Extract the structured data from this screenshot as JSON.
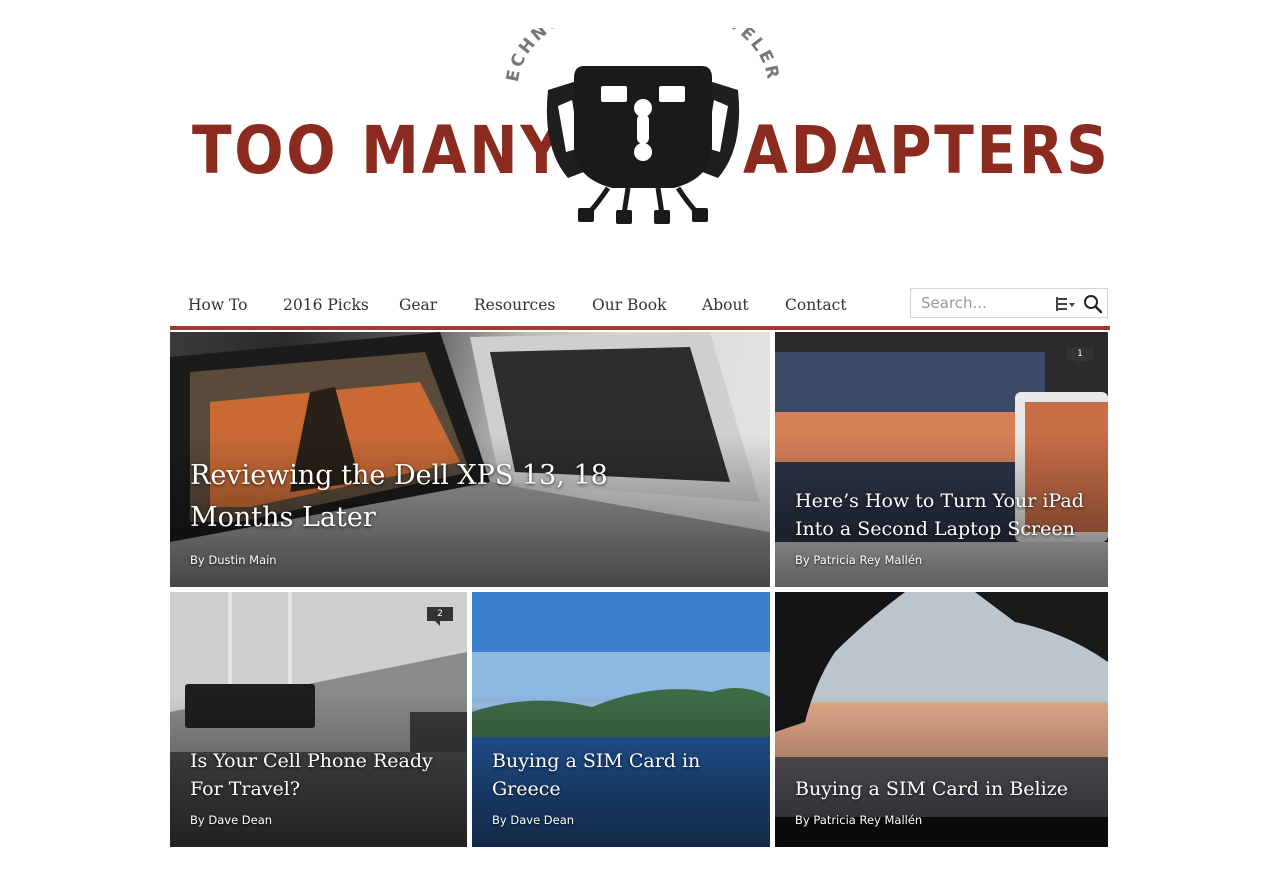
{
  "logo": {
    "left_text": "TOO MANY",
    "right_text": "ADAPTERS",
    "tagline": "TECHNOLOGY FOR TRAVELERS"
  },
  "nav": {
    "items": [
      {
        "label": "How To"
      },
      {
        "label": "2016 Picks"
      },
      {
        "label": "Gear"
      },
      {
        "label": "Resources"
      },
      {
        "label": "Our Book"
      },
      {
        "label": "About"
      },
      {
        "label": "Contact"
      }
    ],
    "search": {
      "placeholder": "Search..."
    }
  },
  "posts": [
    {
      "title": "Reviewing the Dell XPS 13, 18 Months Later",
      "by": "By",
      "author": "Dustin Main",
      "comments": ""
    },
    {
      "title": "Here’s How to Turn Your iPad Into a Second Laptop Screen",
      "by": "By",
      "author": "Patricia Rey Mallén",
      "comments": "1"
    },
    {
      "title": "Is Your Cell Phone Ready For Travel?",
      "by": "By",
      "author": "Dave Dean",
      "comments": "2"
    },
    {
      "title": "Buying a SIM Card in Greece",
      "by": "By",
      "author": "Dave Dean",
      "comments": ""
    },
    {
      "title": "Buying a SIM Card in Belize",
      "by": "By",
      "author": "Patricia Rey Mallén",
      "comments": ""
    }
  ],
  "colors": {
    "brand_red": "#8b2a1e",
    "nav_underline": "#a53a30",
    "badge": "#333333"
  },
  "icons": {
    "search": "search-icon",
    "filter": "filter-list-icon",
    "logo": "adapter-plug-emblem"
  }
}
